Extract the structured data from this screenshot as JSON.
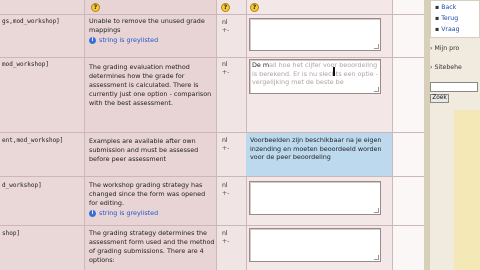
{
  "rows": [
    {
      "ident": "gs,mod_workshop]",
      "original": "Unable to remove the unused grade mappings",
      "greylisted": "string is greylisted",
      "lang": "nl",
      "arrow": "+-",
      "translation": "",
      "translation_faded": ""
    },
    {
      "ident": "mod_workshop]",
      "original": "The grading evaluation method determines how the grade for assessment is calculated. There is currently just one option - comparison with the best assessment.",
      "greylisted": "",
      "lang": "nl",
      "arrow": "+-",
      "translation": "De m",
      "translation_faded": "all hoe het cijfer voor beoordeling is berekend. Er is nu slechts een optie - vergelijking met de beste be"
    },
    {
      "ident": "ent,mod_workshop]",
      "original": "Examples are available after own submission and must be assessed before peer assessment",
      "greylisted": "",
      "lang": "nl",
      "arrow": "+-",
      "translation": "Voorbeelden zijn beschikbaar na je eigen inzending en moeten beoordeeld worden voor de peer beoordeling",
      "translation_faded": ""
    },
    {
      "ident": "d_workshop]",
      "original": "The workshop grading strategy has changed since the form was opened for editing.",
      "greylisted": "string is greylisted",
      "lang": "nl",
      "arrow": "+-",
      "translation": "",
      "translation_faded": ""
    },
    {
      "ident": "shop]",
      "original": "The grading strategy determines the assessment form used and the method of grading submissions. There are 4 options:",
      "greylisted": "",
      "lang": "nl",
      "arrow": "+-",
      "translation": "",
      "translation_faded": ""
    }
  ],
  "sidebar": {
    "links": [
      "Back",
      "Terug",
      "Vraag"
    ],
    "mijn_profiel": "Mijn pro",
    "sitebeheer": "Sitebehe",
    "search_button": "Zoek"
  },
  "icons": {
    "help": "help-icon",
    "info": "info-icon",
    "bullet": "bullet-icon"
  },
  "colors": {
    "row_pink": "#ead7d7",
    "translated_blue": "#bcd9ee",
    "link_blue": "#1a4aa8",
    "help_yellow": "#f6c93a"
  }
}
